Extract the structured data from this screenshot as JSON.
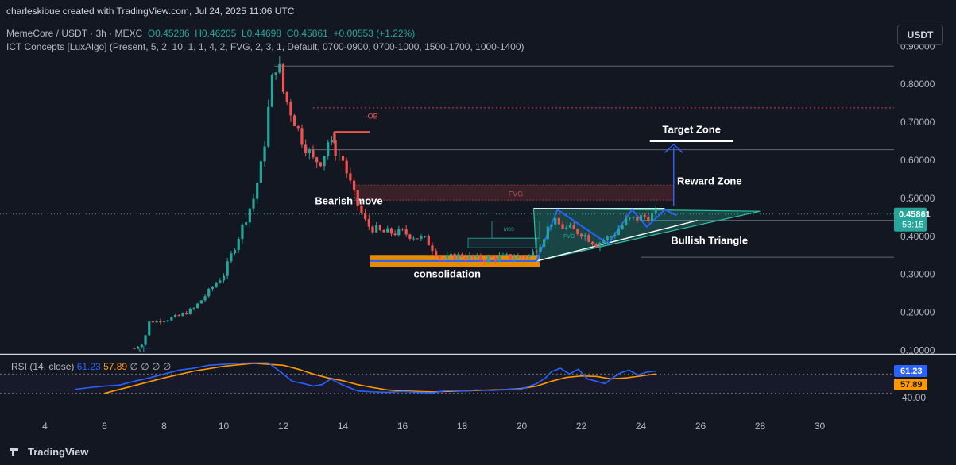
{
  "header": {
    "credit": "charleskibue created with TradingView.com, Jul 24, 2025 11:06 UTC",
    "symbol": "MemeCore / USDT · 3h · MEXC",
    "ohlc": {
      "o": "0.45286",
      "h": "0.46205",
      "l": "0.44698",
      "c": "0.45861",
      "chg": "+0.00553 (+1.22%)"
    },
    "indicator": "ICT Concepts [LuxAlgo] (Present, 5, 2, 10, 1, 1, 4, 2, FVG, 2, 3, 1, Default, 0700-0900, 0700-1000, 1500-1700, 1000-1400)"
  },
  "unit_button": "USDT",
  "price_label": {
    "value": "0.45861",
    "countdown": "53:15"
  },
  "rsi": {
    "title": "RSI (14, close)",
    "rsi_value": "61.23",
    "ma_value": "57.89",
    "placeholders": "∅ ∅ ∅ ∅",
    "axis_label": "40.00"
  },
  "footer": {
    "brand": "TradingView"
  },
  "annotations": {
    "ob": "-OB",
    "fvg": "FVG",
    "fvg_small": "FVG",
    "mss": "MSS",
    "vi": "VI",
    "bearish": "Bearish move",
    "consolidation": "consolidation",
    "target": "Target Zone",
    "reward": "Reward Zone",
    "triangle": "Bullish Triangle"
  },
  "colors": {
    "up": "#26a69a",
    "down": "#ef5350",
    "bg": "#131722",
    "rsi": "#2962ff",
    "rsi_ma": "#ff9800",
    "triangle": "#2ebfa3"
  },
  "chart_data": {
    "type": "candlestick",
    "price_axis": {
      "min": 0.1,
      "max": 0.9,
      "ticks": [
        "0.90000",
        "0.80000",
        "0.70000",
        "0.60000",
        "0.50000",
        "0.40000",
        "0.30000",
        "0.20000",
        "0.10000"
      ]
    },
    "x_axis": {
      "min": 3,
      "max": 31,
      "ticks": [
        "4",
        "6",
        "8",
        "10",
        "12",
        "14",
        "16",
        "18",
        "20",
        "22",
        "24",
        "26",
        "28",
        "30"
      ]
    },
    "levels": [
      0.848,
      0.738,
      0.628,
      0.442,
      0.345
    ],
    "close_path": [
      [
        7.0,
        0.105
      ],
      [
        7.3,
        0.12
      ],
      [
        7.5,
        0.175
      ],
      [
        8.0,
        0.18
      ],
      [
        8.5,
        0.19
      ],
      [
        9.0,
        0.21
      ],
      [
        9.5,
        0.255
      ],
      [
        10.0,
        0.3
      ],
      [
        10.5,
        0.4
      ],
      [
        11.0,
        0.5
      ],
      [
        11.3,
        0.6
      ],
      [
        11.6,
        0.8
      ],
      [
        11.8,
        0.87
      ],
      [
        12.0,
        0.78
      ],
      [
        12.3,
        0.72
      ],
      [
        12.6,
        0.66
      ],
      [
        13.0,
        0.6
      ],
      [
        13.3,
        0.6
      ],
      [
        13.5,
        0.65
      ],
      [
        14.0,
        0.6
      ],
      [
        14.4,
        0.5
      ],
      [
        14.8,
        0.43
      ],
      [
        15.3,
        0.41
      ],
      [
        16.0,
        0.41
      ],
      [
        16.8,
        0.39
      ],
      [
        17.3,
        0.34
      ],
      [
        18.0,
        0.35
      ],
      [
        18.5,
        0.34
      ],
      [
        19.5,
        0.345
      ],
      [
        20.3,
        0.35
      ],
      [
        20.6,
        0.38
      ],
      [
        21.0,
        0.44
      ],
      [
        21.5,
        0.42
      ],
      [
        22.0,
        0.41
      ],
      [
        22.5,
        0.38
      ],
      [
        23.0,
        0.4
      ],
      [
        23.5,
        0.44
      ],
      [
        24.0,
        0.45
      ],
      [
        24.5,
        0.458
      ]
    ],
    "rsi_series": [
      [
        5.0,
        0.38
      ],
      [
        5.5,
        0.42
      ],
      [
        6.0,
        0.45
      ],
      [
        6.5,
        0.47
      ],
      [
        7.0,
        0.55
      ],
      [
        7.5,
        0.62
      ],
      [
        8.0,
        0.7
      ],
      [
        8.5,
        0.78
      ],
      [
        9.0,
        0.82
      ],
      [
        9.5,
        0.88
      ],
      [
        10.0,
        0.9
      ],
      [
        10.5,
        0.92
      ],
      [
        11.0,
        0.93
      ],
      [
        11.5,
        0.93
      ],
      [
        12.0,
        0.7
      ],
      [
        12.3,
        0.55
      ],
      [
        12.7,
        0.5
      ],
      [
        13.0,
        0.45
      ],
      [
        13.3,
        0.48
      ],
      [
        13.6,
        0.6
      ],
      [
        13.9,
        0.5
      ],
      [
        14.2,
        0.42
      ],
      [
        14.5,
        0.35
      ],
      [
        15.0,
        0.33
      ],
      [
        15.5,
        0.32
      ],
      [
        16.0,
        0.34
      ],
      [
        16.5,
        0.32
      ],
      [
        17.0,
        0.31
      ],
      [
        17.5,
        0.36
      ],
      [
        18.0,
        0.35
      ],
      [
        18.5,
        0.37
      ],
      [
        19.0,
        0.36
      ],
      [
        19.5,
        0.38
      ],
      [
        20.0,
        0.39
      ],
      [
        20.5,
        0.5
      ],
      [
        20.8,
        0.62
      ],
      [
        21.0,
        0.75
      ],
      [
        21.3,
        0.82
      ],
      [
        21.6,
        0.7
      ],
      [
        21.9,
        0.8
      ],
      [
        22.2,
        0.6
      ],
      [
        22.5,
        0.55
      ],
      [
        22.8,
        0.5
      ],
      [
        23.0,
        0.6
      ],
      [
        23.3,
        0.72
      ],
      [
        23.6,
        0.78
      ],
      [
        23.9,
        0.68
      ],
      [
        24.2,
        0.74
      ],
      [
        24.5,
        0.76
      ]
    ],
    "rsi_ma_series": [
      [
        6.0,
        0.3
      ],
      [
        6.5,
        0.38
      ],
      [
        7.0,
        0.46
      ],
      [
        7.5,
        0.54
      ],
      [
        8.0,
        0.62
      ],
      [
        9.0,
        0.76
      ],
      [
        10.0,
        0.86
      ],
      [
        11.0,
        0.92
      ],
      [
        12.0,
        0.88
      ],
      [
        12.5,
        0.8
      ],
      [
        13.0,
        0.7
      ],
      [
        13.5,
        0.62
      ],
      [
        14.0,
        0.56
      ],
      [
        14.5,
        0.48
      ],
      [
        15.0,
        0.42
      ],
      [
        15.5,
        0.37
      ],
      [
        16.0,
        0.35
      ],
      [
        16.5,
        0.34
      ],
      [
        17.0,
        0.33
      ],
      [
        17.5,
        0.34
      ],
      [
        18.0,
        0.35
      ],
      [
        18.5,
        0.36
      ],
      [
        19.0,
        0.37
      ],
      [
        19.5,
        0.38
      ],
      [
        20.0,
        0.4
      ],
      [
        20.5,
        0.45
      ],
      [
        21.0,
        0.55
      ],
      [
        21.5,
        0.63
      ],
      [
        22.0,
        0.66
      ],
      [
        22.5,
        0.65
      ],
      [
        23.0,
        0.6
      ],
      [
        23.5,
        0.62
      ],
      [
        24.0,
        0.66
      ],
      [
        24.5,
        0.7
      ]
    ]
  }
}
